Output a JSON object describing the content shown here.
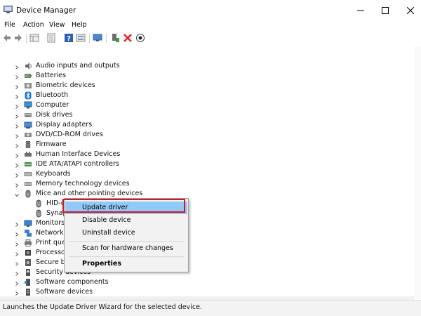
{
  "window": {
    "title": "Device Manager"
  },
  "menubar": {
    "items": [
      "File",
      "Action",
      "View",
      "Help"
    ]
  },
  "toolbar": {
    "buttons": [
      "back-icon",
      "forward-icon",
      "show-hide-icon",
      "properties-icon",
      "help-icon",
      "action-view-icon",
      "scan-hardware-icon",
      "update-driver-icon",
      "uninstall-icon",
      "disable-icon"
    ]
  },
  "tree": {
    "items": [
      {
        "label": "Audio inputs and outputs",
        "icon": "speaker-icon"
      },
      {
        "label": "Batteries",
        "icon": "battery-icon"
      },
      {
        "label": "Biometric devices",
        "icon": "biometric-icon"
      },
      {
        "label": "Bluetooth",
        "icon": "bluetooth-icon"
      },
      {
        "label": "Computer",
        "icon": "computer-icon"
      },
      {
        "label": "Disk drives",
        "icon": "disk-icon"
      },
      {
        "label": "Display adapters",
        "icon": "display-icon"
      },
      {
        "label": "DVD/CD-ROM drives",
        "icon": "dvd-icon"
      },
      {
        "label": "Firmware",
        "icon": "firmware-icon"
      },
      {
        "label": "Human Interface Devices",
        "icon": "hid-icon"
      },
      {
        "label": "IDE ATA/ATAPI controllers",
        "icon": "ide-icon"
      },
      {
        "label": "Keyboards",
        "icon": "keyboard-icon"
      },
      {
        "label": "Memory technology devices",
        "icon": "memory-icon"
      },
      {
        "label": "Mice and other pointing devices",
        "icon": "mouse-icon",
        "expanded": true
      },
      {
        "label": "HID-c",
        "icon": "mouse-icon",
        "child": true
      },
      {
        "label": "Synap",
        "icon": "mouse-icon",
        "child": true
      },
      {
        "label": "Monitors",
        "icon": "monitor-icon"
      },
      {
        "label": "Network a",
        "icon": "network-icon"
      },
      {
        "label": "Print queu",
        "icon": "printer-icon"
      },
      {
        "label": "Processor",
        "icon": "processor-icon"
      },
      {
        "label": "Secure bio",
        "icon": "secure-icon"
      },
      {
        "label": "Security devices",
        "icon": "security-icon"
      },
      {
        "label": "Software components",
        "icon": "component-icon"
      },
      {
        "label": "Software devices",
        "icon": "software-icon"
      }
    ]
  },
  "context_menu": {
    "items": [
      {
        "label": "Update driver",
        "highlighted": true
      },
      {
        "label": "Disable device"
      },
      {
        "label": "Uninstall device"
      },
      {
        "label": "Scan for hardware changes"
      },
      {
        "label": "Properties",
        "bold": true
      }
    ]
  },
  "status": {
    "text": "Launches the Update Driver Wizard for the selected device."
  },
  "colors": {
    "highlight": "#91c9f7",
    "annotation": "#d6161f"
  }
}
